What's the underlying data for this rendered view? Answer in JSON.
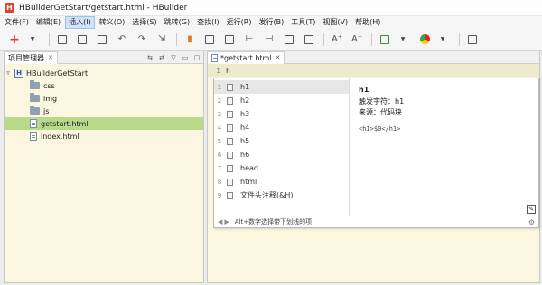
{
  "window": {
    "app_icon_letter": "H",
    "title": "HBuilderGetStart/getstart.html  -  HBuilder"
  },
  "menu": [
    {
      "label": "文件(F)"
    },
    {
      "label": "编辑(E)"
    },
    {
      "label": "插入(I)",
      "active": true
    },
    {
      "label": "转义(O)"
    },
    {
      "label": "选择(S)"
    },
    {
      "label": "跳转(G)"
    },
    {
      "label": "查找(I)"
    },
    {
      "label": "运行(R)"
    },
    {
      "label": "发行(B)"
    },
    {
      "label": "工具(T)"
    },
    {
      "label": "视图(V)"
    },
    {
      "label": "帮助(H)"
    }
  ],
  "toolbar": {
    "new_glyph": "+",
    "undo_glyph": "↶",
    "redo_glyph": "↷",
    "font_bigger": "A⁺",
    "font_smaller": "A⁻"
  },
  "project_pane": {
    "tab_label": "项目管理器",
    "close_glyph": "✕",
    "tree": [
      {
        "label": "HBuilderGetStart",
        "kind": "project",
        "expanded": true
      },
      {
        "label": "css",
        "kind": "folder"
      },
      {
        "label": "img",
        "kind": "folder"
      },
      {
        "label": "js",
        "kind": "folder"
      },
      {
        "label": "getstart.html",
        "kind": "file",
        "selected": true
      },
      {
        "label": "index.html",
        "kind": "file"
      }
    ]
  },
  "editor": {
    "tab_label": "*getstart.html",
    "close_glyph": "✕",
    "line_number": "1",
    "line_text": "h"
  },
  "autocomplete": {
    "items": [
      {
        "num": "1",
        "label": "h1",
        "selected": true
      },
      {
        "num": "2",
        "label": "h2"
      },
      {
        "num": "3",
        "label": "h3"
      },
      {
        "num": "4",
        "label": "h4"
      },
      {
        "num": "5",
        "label": "h5"
      },
      {
        "num": "6",
        "label": "h6"
      },
      {
        "num": "7",
        "label": "head"
      },
      {
        "num": "8",
        "label": "html"
      },
      {
        "num": "9",
        "label": "文件头注释(&H)"
      }
    ],
    "detail": {
      "title": "h1",
      "trigger": "触发字符：h1",
      "source": "来源：代码块",
      "snippet": "<h1>$0</h1>"
    },
    "footer": "Alt+数字选择带下划线的项",
    "nav_prev": "◀",
    "nav_next": "▶"
  }
}
